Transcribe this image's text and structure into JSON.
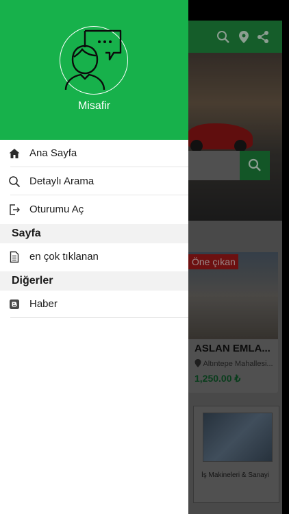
{
  "background": {
    "featured_badge": "Öne çıkan",
    "listing_title": "ASLAN EMLA...",
    "listing_location": "Altıntepe Mahallesi...",
    "listing_price": "1,250.00 ₺",
    "category_label": "İş Makineleri & Sanayi"
  },
  "drawer": {
    "username": "Misafir",
    "menu": [
      {
        "label": "Ana Sayfa",
        "icon": "home-icon"
      },
      {
        "label": "Detaylı Arama",
        "icon": "search-icon"
      },
      {
        "label": "Oturumu Aç",
        "icon": "login-icon"
      }
    ],
    "sections": [
      {
        "title": "Sayfa",
        "items": [
          {
            "label": "en çok tıklanan",
            "icon": "document-icon"
          }
        ]
      },
      {
        "title": "Diğerler",
        "items": [
          {
            "label": "Haber",
            "icon": "blog-icon"
          }
        ]
      }
    ]
  },
  "colors": {
    "primary_green": "#17b14b",
    "badge_red": "#a01818"
  }
}
